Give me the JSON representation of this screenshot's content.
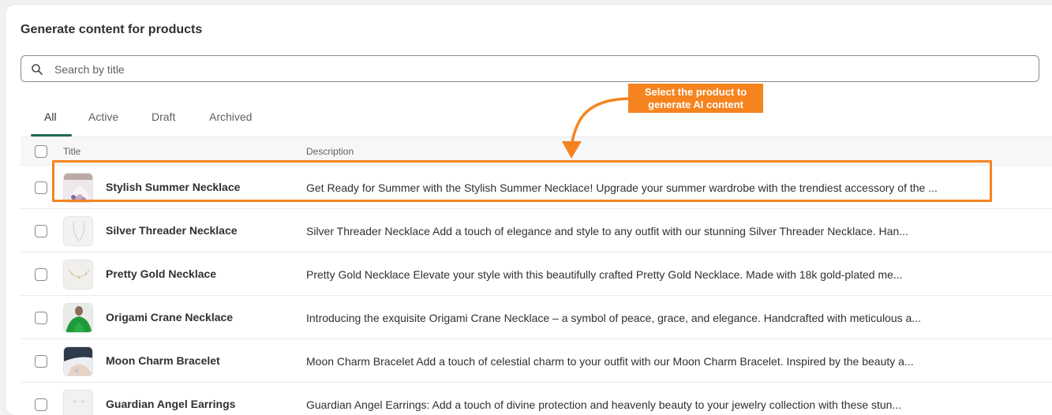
{
  "card": {
    "title": "Generate content for products"
  },
  "search": {
    "placeholder": "Search by title",
    "value": ""
  },
  "tabs": [
    {
      "label": "All",
      "active": true
    },
    {
      "label": "Active",
      "active": false
    },
    {
      "label": "Draft",
      "active": false
    },
    {
      "label": "Archived",
      "active": false
    }
  ],
  "table": {
    "headers": {
      "title": "Title",
      "description": "Description"
    },
    "rows": [
      {
        "title": "Stylish Summer Necklace",
        "description": "Get Ready for Summer with the Stylish Summer Necklace! Upgrade your summer wardrobe with the trendiest accessory of the ..."
      },
      {
        "title": "Silver Threader Necklace",
        "description": "Silver Threader Necklace Add a touch of elegance and style to any outfit with our stunning Silver Threader Necklace. Han..."
      },
      {
        "title": "Pretty Gold Necklace",
        "description": "Pretty Gold Necklace Elevate your style with this beautifully crafted Pretty Gold Necklace. Made with 18k gold-plated me..."
      },
      {
        "title": "Origami Crane Necklace",
        "description": "Introducing the exquisite Origami Crane Necklace – a symbol of peace, grace, and elegance. Handcrafted with meticulous a..."
      },
      {
        "title": "Moon Charm Bracelet",
        "description": "Moon Charm Bracelet Add a touch of celestial charm to your outfit with our Moon Charm Bracelet. Inspired by the beauty a..."
      },
      {
        "title": "Guardian Angel Earrings",
        "description": "Guardian Angel Earrings: Add a touch of divine protection and heavenly beauty to your jewelry collection with these stun..."
      }
    ]
  },
  "annotation": {
    "callout_line1": "Select the product to",
    "callout_line2": "generate AI content",
    "color": "#f5841f"
  },
  "colors": {
    "tab_underline": "#1e6b52",
    "background": "#f1f1f1"
  }
}
